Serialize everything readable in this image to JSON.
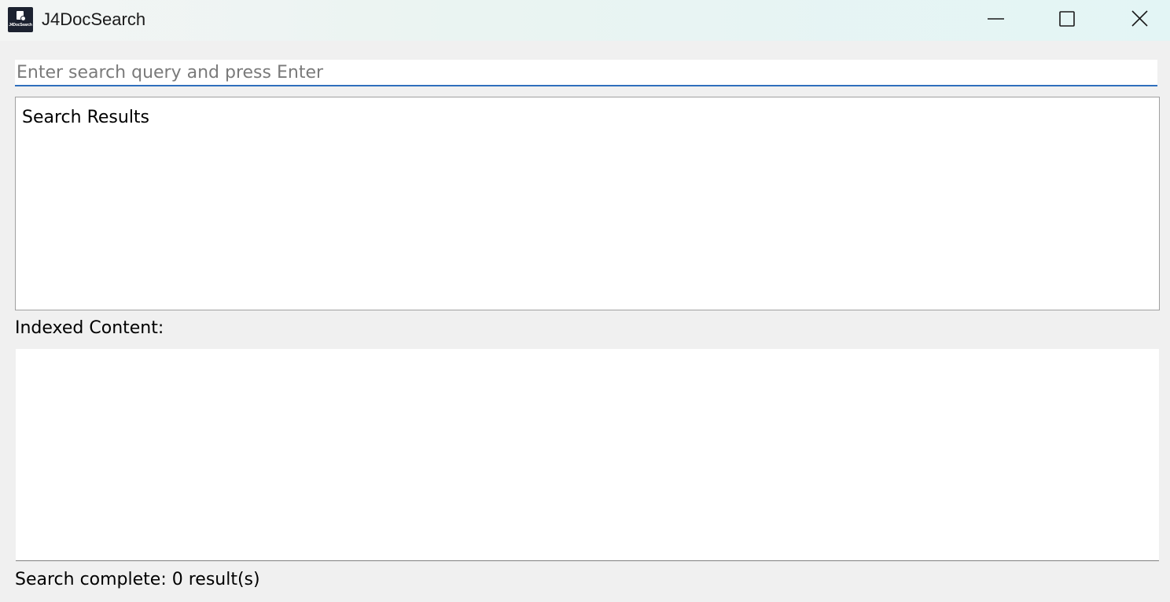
{
  "window": {
    "title": "J4DocSearch",
    "icon_caption": "J4DocSearch",
    "controls": {
      "minimize": "minimize-icon",
      "maximize": "maximize-icon",
      "close": "close-icon"
    }
  },
  "search": {
    "placeholder": "Enter search query and press Enter",
    "value": ""
  },
  "results": {
    "header": "Search Results",
    "items": []
  },
  "indexed": {
    "label": "Indexed Content:",
    "content": ""
  },
  "status": {
    "text": "Search complete: 0 result(s)"
  },
  "colors": {
    "accent": "#2f6fbd",
    "background": "#f0f0f0",
    "panel": "#ffffff",
    "app_icon": "#1c2230"
  }
}
